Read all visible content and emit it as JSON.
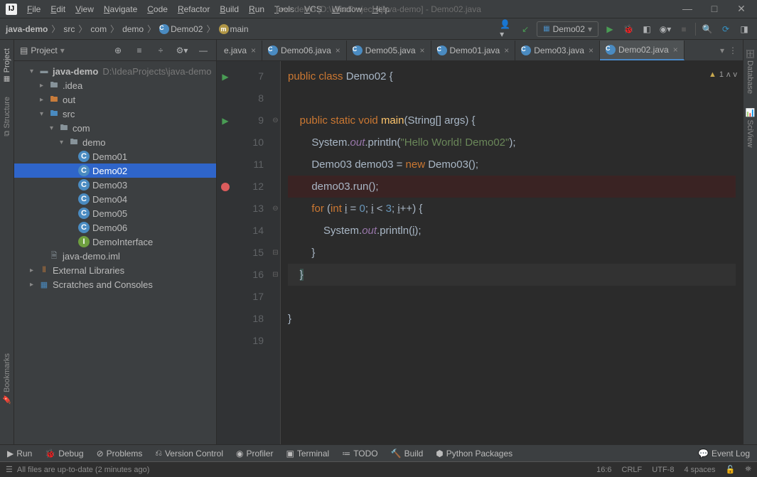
{
  "window": {
    "title": "java-demo [D:\\IdeaProjects\\java-demo] - Demo02.java"
  },
  "menu": [
    "File",
    "Edit",
    "View",
    "Navigate",
    "Code",
    "Refactor",
    "Build",
    "Run",
    "Tools",
    "VCS",
    "Window",
    "Help"
  ],
  "breadcrumb": {
    "project": "java-demo",
    "parts": [
      "src",
      "com",
      "demo",
      "Demo02",
      "main"
    ]
  },
  "run_config": "Demo02",
  "project_panel": {
    "title": "Project",
    "root": "java-demo",
    "root_path": "D:\\IdeaProjects\\java-demo",
    "items": [
      {
        "indent": 1,
        "arrow": "▾",
        "type": "module",
        "label": "java-demo",
        "extra": "D:\\IdeaProjects\\java-demo"
      },
      {
        "indent": 2,
        "arrow": "▸",
        "type": "folder",
        "label": ".idea"
      },
      {
        "indent": 2,
        "arrow": "▸",
        "type": "folder-orange",
        "label": "out"
      },
      {
        "indent": 2,
        "arrow": "▾",
        "type": "folder-blue",
        "label": "src"
      },
      {
        "indent": 3,
        "arrow": "▾",
        "type": "folder",
        "label": "com"
      },
      {
        "indent": 4,
        "arrow": "▾",
        "type": "folder",
        "label": "demo"
      },
      {
        "indent": 5,
        "arrow": "",
        "type": "class",
        "label": "Demo01"
      },
      {
        "indent": 5,
        "arrow": "",
        "type": "class",
        "label": "Demo02",
        "selected": true
      },
      {
        "indent": 5,
        "arrow": "",
        "type": "class",
        "label": "Demo03"
      },
      {
        "indent": 5,
        "arrow": "",
        "type": "class",
        "label": "Demo04"
      },
      {
        "indent": 5,
        "arrow": "",
        "type": "class",
        "label": "Demo05"
      },
      {
        "indent": 5,
        "arrow": "",
        "type": "class",
        "label": "Demo06"
      },
      {
        "indent": 5,
        "arrow": "",
        "type": "interface",
        "label": "DemoInterface"
      },
      {
        "indent": 2,
        "arrow": "",
        "type": "file",
        "label": "java-demo.iml"
      },
      {
        "indent": 1,
        "arrow": "▸",
        "type": "lib",
        "label": "External Libraries"
      },
      {
        "indent": 1,
        "arrow": "▸",
        "type": "scratch",
        "label": "Scratches and Consoles"
      }
    ]
  },
  "tabs": [
    {
      "name": "e.java",
      "partial": true
    },
    {
      "name": "Demo06.java"
    },
    {
      "name": "Demo05.java"
    },
    {
      "name": "Demo01.java"
    },
    {
      "name": "Demo03.java"
    },
    {
      "name": "Demo02.java",
      "active": true
    }
  ],
  "editor": {
    "warning_count": "1",
    "lines": [
      {
        "n": 7,
        "icon": "run",
        "html": "<span class='kw'>public</span> <span class='kw'>class</span> <span class='cls'>Demo02</span> {"
      },
      {
        "n": 8,
        "html": ""
      },
      {
        "n": 9,
        "icon": "run",
        "fold": "⊖",
        "html": "    <span class='kw'>public</span> <span class='kw'>static</span> <span class='kw'>void</span> <span class='m'>main</span>(String[] args) {"
      },
      {
        "n": 10,
        "html": "        System.<span class='field'>out</span>.println(<span class='str'>\"Hello World! Demo02\"</span>);"
      },
      {
        "n": 11,
        "html": "        Demo03 demo03 = <span class='kw'>new</span> Demo03();"
      },
      {
        "n": 12,
        "icon": "bp",
        "bp": true,
        "html": "        demo03.run();"
      },
      {
        "n": 13,
        "fold": "⊖",
        "html": "        <span class='kw'>for</span> (<span class='kw'>int</span> <u>i</u> = <span class='num'>0</span>; <u>i</u> &lt; <span class='num'>3</span>; <u>i</u>++) {"
      },
      {
        "n": 14,
        "html": "            System.<span class='field'>out</span>.println(<u>i</u>);"
      },
      {
        "n": 15,
        "fold": "⊟",
        "html": "        }"
      },
      {
        "n": 16,
        "fold": "⊟",
        "caret": true,
        "html": "    <span style='background:#3b514d'>}</span>"
      },
      {
        "n": 17,
        "html": ""
      },
      {
        "n": 18,
        "html": "}"
      },
      {
        "n": 19,
        "html": ""
      }
    ]
  },
  "left_tools": [
    "Project",
    "Structure",
    "Bookmarks"
  ],
  "right_tools": [
    "Database",
    "SciView"
  ],
  "bottom_tools": [
    {
      "icon": "▶",
      "label": "Run"
    },
    {
      "icon": "🐞",
      "label": "Debug"
    },
    {
      "icon": "⊘",
      "label": "Problems"
    },
    {
      "icon": "⎌",
      "label": "Version Control"
    },
    {
      "icon": "◉",
      "label": "Profiler"
    },
    {
      "icon": "▣",
      "label": "Terminal"
    },
    {
      "icon": "≔",
      "label": "TODO"
    },
    {
      "icon": "🔨",
      "label": "Build"
    },
    {
      "icon": "⬢",
      "label": "Python Packages"
    }
  ],
  "event_log": "Event Log",
  "status": {
    "msg": "All files are up-to-date (2 minutes ago)",
    "pos": "16:6",
    "eol": "CRLF",
    "enc": "UTF-8",
    "indent": "4 spaces"
  }
}
